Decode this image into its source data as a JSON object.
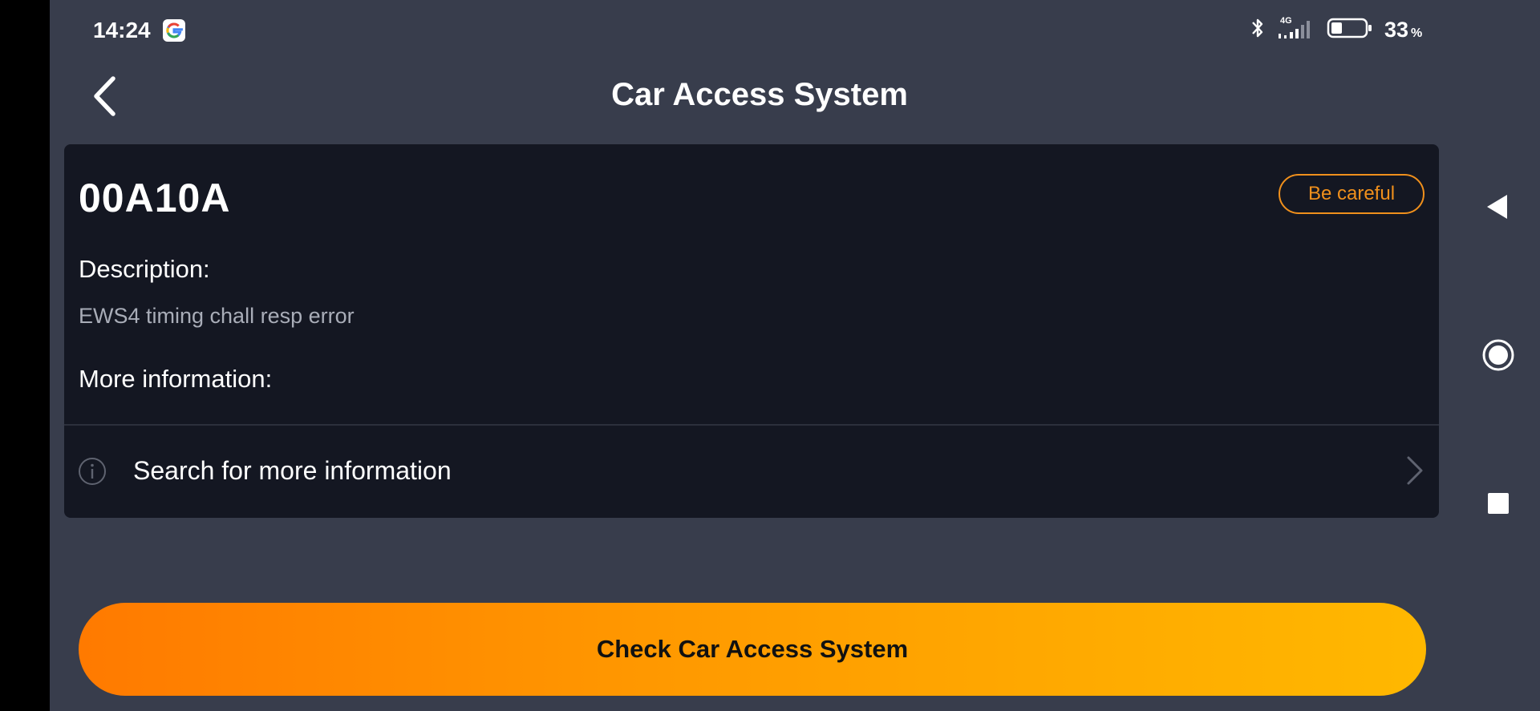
{
  "status_bar": {
    "time": "14:24",
    "network": "4G",
    "battery_percent": "33",
    "battery_unit": "%",
    "battery_level": 0.33
  },
  "header": {
    "title": "Car Access System"
  },
  "fault": {
    "code": "00A10A",
    "severity_badge": "Be careful",
    "description_label": "Description:",
    "description_value": "EWS4 timing chall resp error",
    "more_info_label": "More information:",
    "search_label": "Search for more information"
  },
  "actions": {
    "primary_button": "Check Car Access System"
  },
  "colors": {
    "background": "#383d4c",
    "card": "#141722",
    "accent": "#f0901c",
    "button_gradient_start": "#ff7a00",
    "button_gradient_end": "#ffb800"
  },
  "icons": {
    "back": "chevron-left-icon",
    "google": "google-icon",
    "bluetooth": "bluetooth-icon",
    "signal": "signal-icon",
    "battery": "battery-icon",
    "info": "info-icon",
    "chevron": "chevron-right-icon",
    "nav_back": "nav-back-triangle-icon",
    "nav_home": "nav-home-circle-icon",
    "nav_recents": "nav-recents-square-icon"
  }
}
